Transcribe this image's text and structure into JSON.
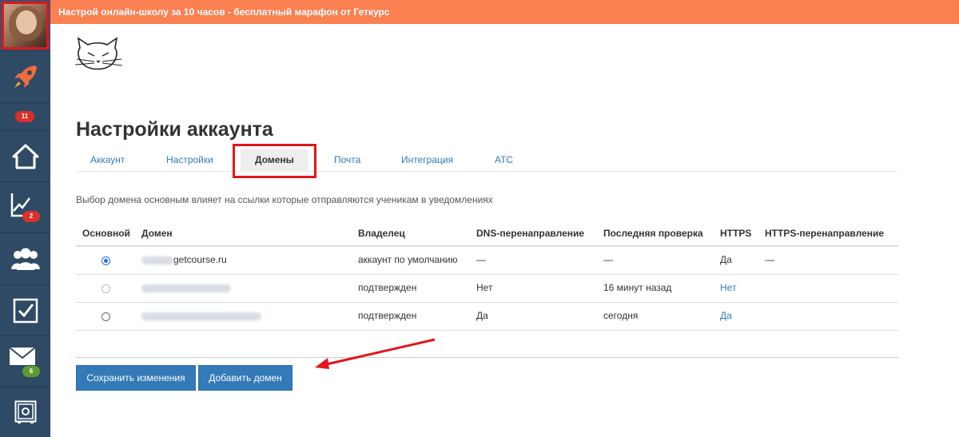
{
  "banner": {
    "text": "Настрой онлайн-школу за 10 часов - бесплатный марафон от Геткурс"
  },
  "sidebar": {
    "items": [
      {
        "icon": "rocket-icon",
        "badge": "11"
      },
      {
        "icon": "home-icon"
      },
      {
        "icon": "chart-icon",
        "badge": "2"
      },
      {
        "icon": "users-icon"
      },
      {
        "icon": "checkbox-icon"
      },
      {
        "icon": "mail-icon",
        "badge": "6"
      },
      {
        "icon": "safe-icon"
      }
    ]
  },
  "page": {
    "title": "Настройки аккаунта"
  },
  "tabs": [
    {
      "label": "Аккаунт"
    },
    {
      "label": "Настройки"
    },
    {
      "label": "Домены",
      "active": true
    },
    {
      "label": "Почта"
    },
    {
      "label": "Интеграция"
    },
    {
      "label": "АТС"
    }
  ],
  "info_text": "Выбор домена основным влияет на ссылки которые отправляются ученикам в уведомлениях",
  "table": {
    "headers": [
      "Основной",
      "Домен",
      "Владелец",
      "DNS-перенаправление",
      "Последняя проверка",
      "HTTPS",
      "HTTPS-перенаправление"
    ],
    "rows": [
      {
        "selected": true,
        "domain": "getcourse.ru",
        "owner": "аккаунт по умолчанию",
        "dns": "—",
        "last_check": "—",
        "https": "Да",
        "https_redirect": "—"
      },
      {
        "selected": false,
        "domain": "",
        "owner": "подтвержден",
        "dns": "Нет",
        "last_check": "16 минут назад",
        "https": "Нет",
        "https_redirect": ""
      },
      {
        "selected": false,
        "domain": "",
        "owner": "подтвержден",
        "dns": "Да",
        "last_check": "сегодня",
        "https": "Да",
        "https_redirect": ""
      }
    ]
  },
  "buttons": {
    "save": "Сохранить изменения",
    "add_domain": "Добавить домен"
  },
  "colors": {
    "banner": "#fa8052",
    "sidebar": "#2e4a64",
    "link": "#337ab7",
    "highlight": "#e0161b"
  }
}
